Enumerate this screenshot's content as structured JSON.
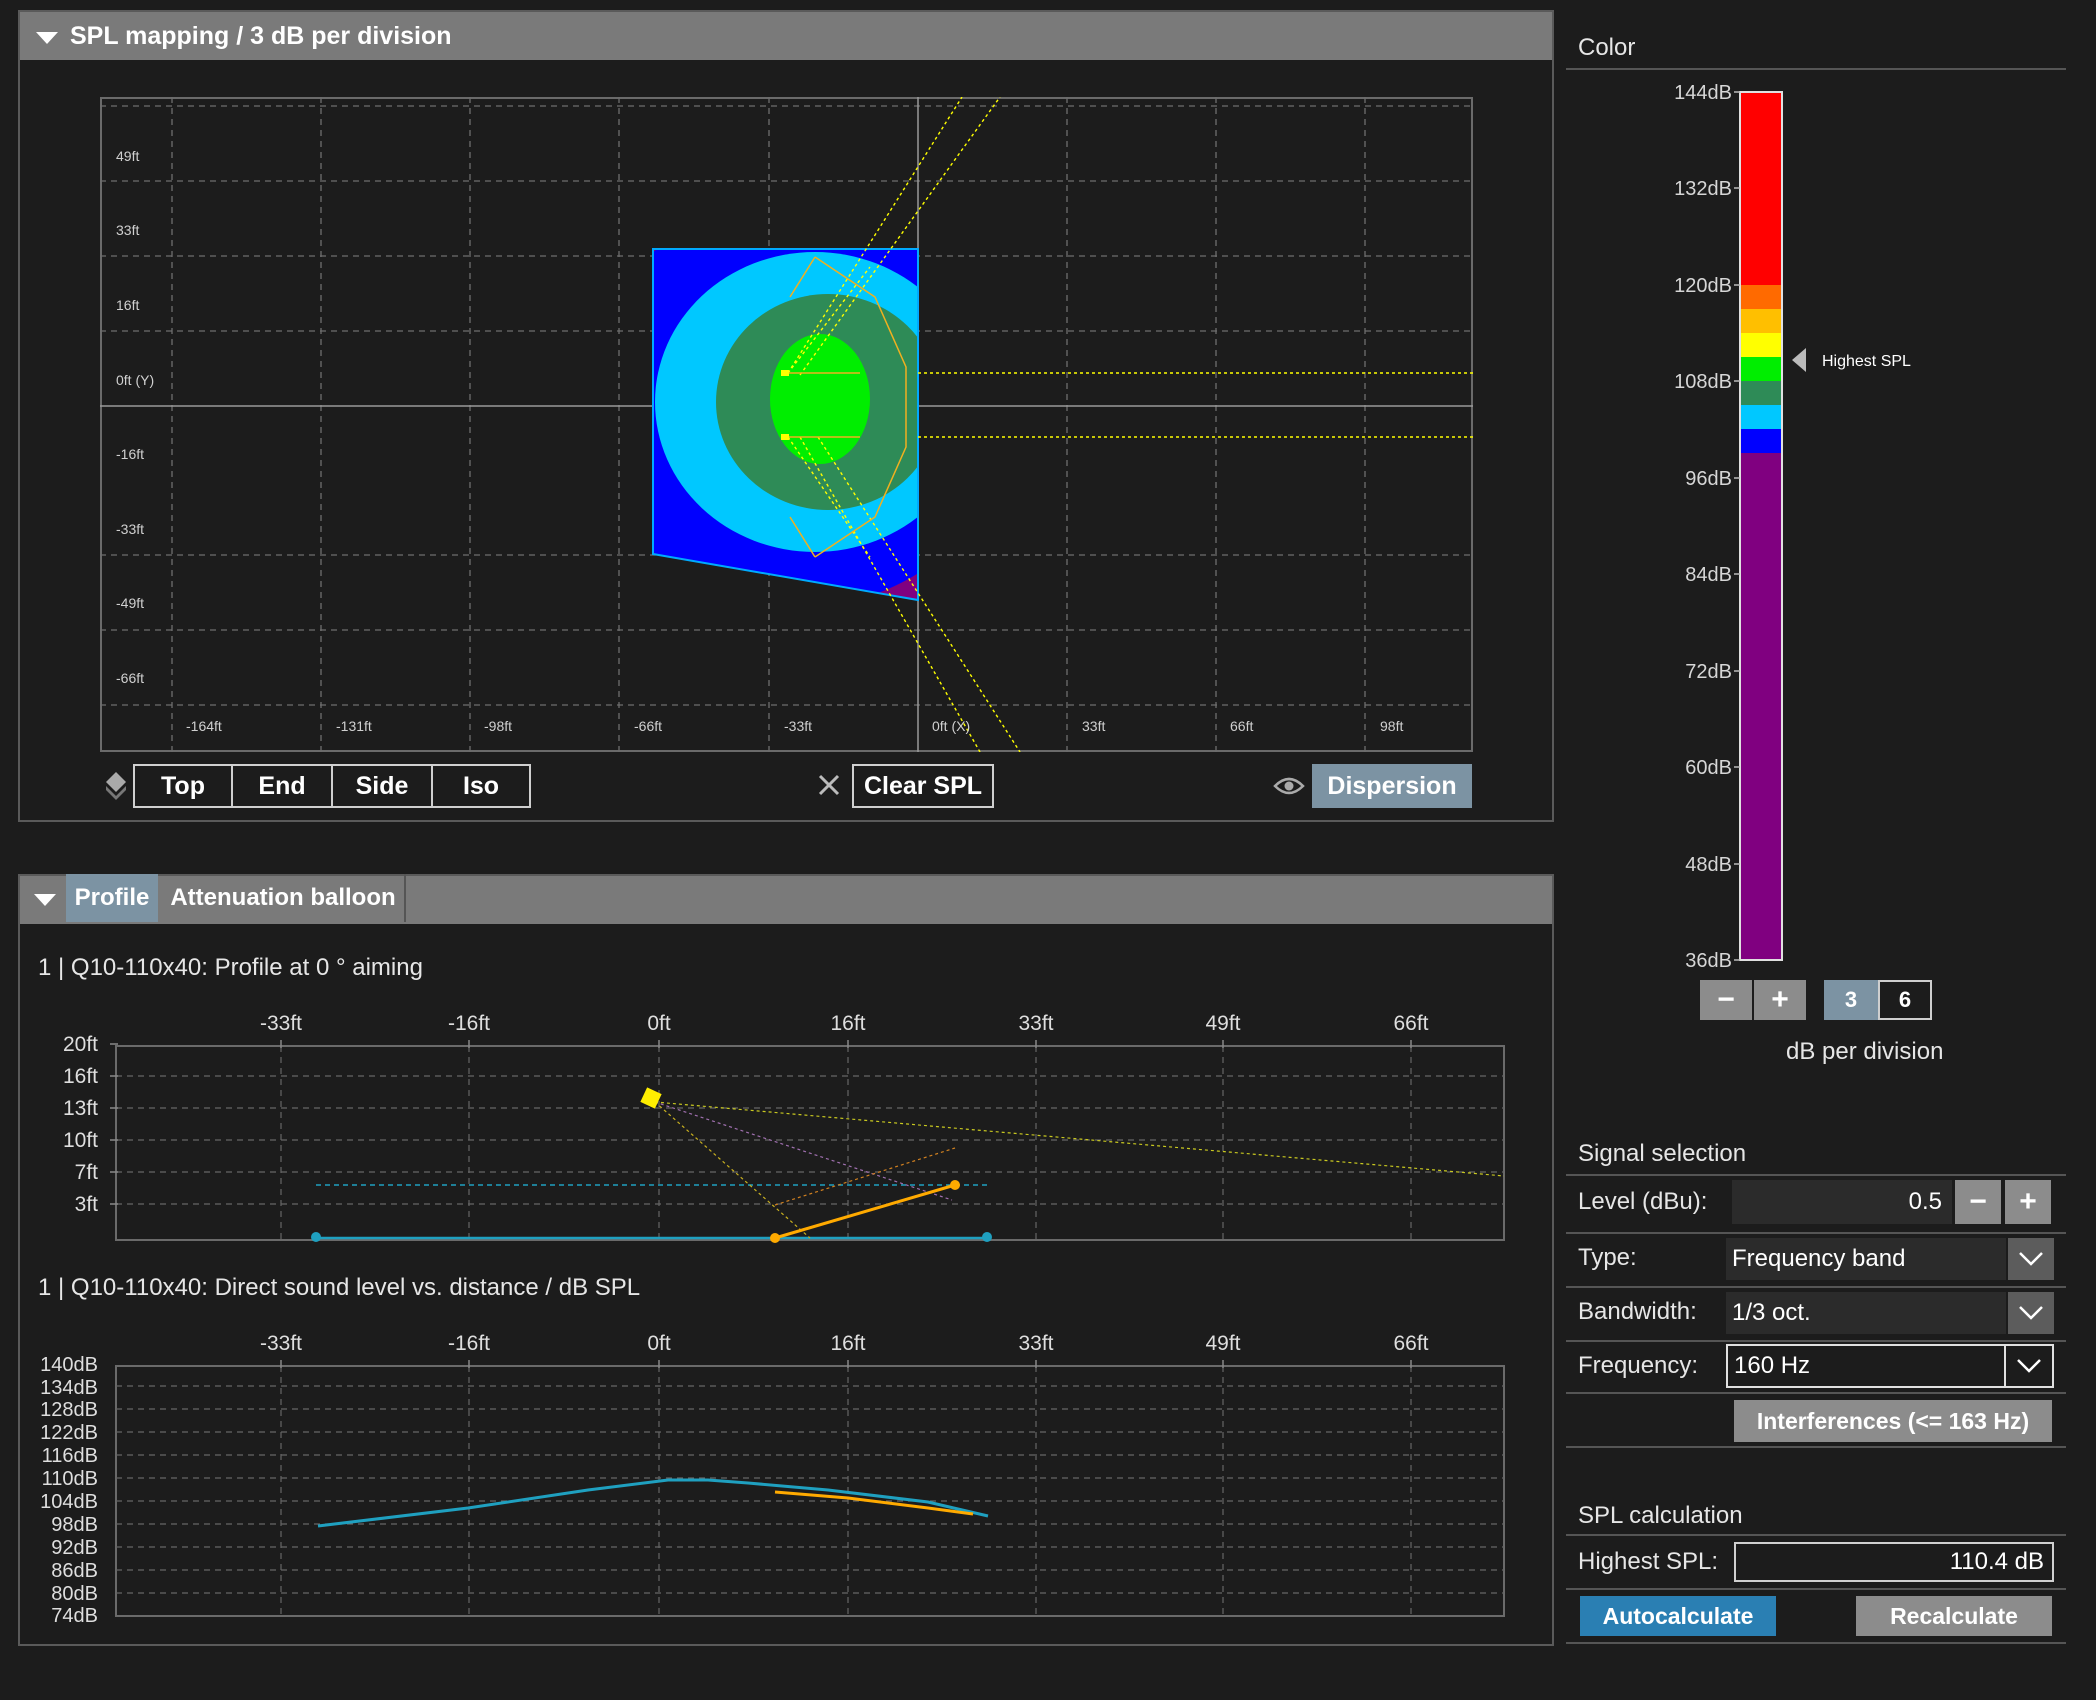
{
  "spl_panel": {
    "title": "SPL mapping / 3 dB per division",
    "y_labels": [
      "49ft",
      "33ft",
      "16ft",
      "0ft (Y)",
      "-16ft",
      "-33ft",
      "-49ft",
      "-66ft"
    ],
    "x_labels": [
      "-164ft",
      "-131ft",
      "-98ft",
      "-66ft",
      "-33ft",
      "0ft (X)",
      "33ft",
      "66ft",
      "98ft"
    ],
    "view_buttons": [
      "Top",
      "End",
      "Side",
      "Iso"
    ],
    "clear_label": "Clear SPL",
    "dispersion_label": "Dispersion"
  },
  "bottom_panel": {
    "tabs": [
      "Profile",
      "Attenuation balloon"
    ],
    "profile_title": "1 | Q10-110x40: Profile at 0 ° aiming",
    "direct_title": "1 | Q10-110x40: Direct sound level vs. distance / dB SPL",
    "x_labels": [
      "-33ft",
      "-16ft",
      "0ft",
      "16ft",
      "33ft",
      "49ft",
      "66ft"
    ],
    "profile_y_labels": [
      "20ft",
      "16ft",
      "13ft",
      "10ft",
      "7ft",
      "3ft"
    ],
    "direct_y_labels": [
      "140dB",
      "134dB",
      "128dB",
      "122dB",
      "116dB",
      "110dB",
      "104dB",
      "98dB",
      "92dB",
      "86dB",
      "80dB",
      "74dB"
    ]
  },
  "color_panel": {
    "title": "Color",
    "scale_labels": [
      "144dB",
      "132dB",
      "120dB",
      "108dB",
      "96dB",
      "84dB",
      "72dB",
      "60dB",
      "48dB",
      "36dB"
    ],
    "highest_marker": "Highest SPL",
    "division_options": [
      "3",
      "6"
    ],
    "division_selected": "3",
    "minus_label": "−",
    "plus_label": "+",
    "db_per_division_label": "dB per division",
    "colors": {
      "red": "#ff0000",
      "orange": "#ff6a00",
      "amber": "#ffbf00",
      "yellow": "#ffff00",
      "green": "#00ee00",
      "seagreen": "#2e8b57",
      "cyan": "#00c8ff",
      "blue": "#0000ff",
      "purple": "#800080"
    }
  },
  "signal": {
    "title": "Signal selection",
    "level_label": "Level (dBu):",
    "level_value": "0.5",
    "type_label": "Type:",
    "type_value": "Frequency band",
    "bandwidth_label": "Bandwidth:",
    "bandwidth_value": "1/3 oct.",
    "frequency_label": "Frequency:",
    "frequency_value": "160 Hz",
    "interferences_label": "Interferences (<= 163 Hz)"
  },
  "spl_calc": {
    "title": "SPL calculation",
    "highest_label": "Highest SPL:",
    "highest_value": "110.4 dB",
    "autocalc_label": "Autocalculate",
    "recalc_label": "Recalculate"
  }
}
